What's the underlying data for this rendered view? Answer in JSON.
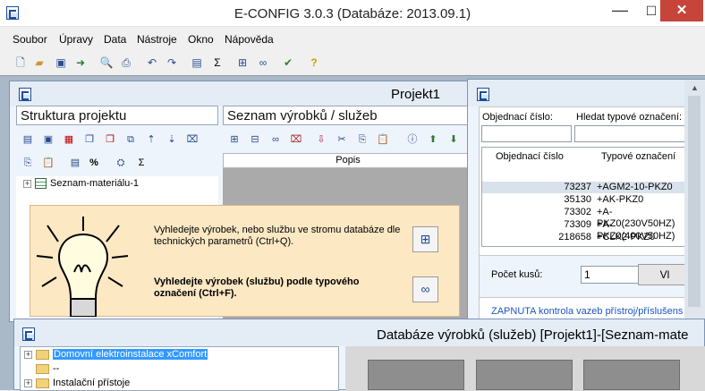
{
  "app": {
    "title": "E-CONFIG 3.0.3  (Databáze: 2013.09.1)",
    "min": "—",
    "max": "☐",
    "close": "✕"
  },
  "menu": [
    "Soubor",
    "Úpravy",
    "Data",
    "Nástroje",
    "Okno",
    "Nápověda"
  ],
  "toolbar_icons": [
    "new-file-icon",
    "open-folder-icon",
    "save-icon",
    "export-icon",
    "print-preview-icon",
    "print-icon",
    "undo-icon",
    "redo-icon",
    "properties-icon",
    "sum-icon",
    "tree-search-icon",
    "binoculars-icon",
    "check-list-icon",
    "help-icon"
  ],
  "project_window": {
    "title": "Projekt1",
    "structure_header": "Struktura projektu",
    "products_header": "Seznam výrobků / služeb",
    "column_popis": "Popis",
    "tree_item": "Seznam-materiálu-1",
    "percent": "%",
    "sigma": "Σ"
  },
  "hint": {
    "text1": "Vyhledejte výrobek, nebo službu ve stromu databáze dle technických parametrů (Ctrl+Q).",
    "text2": "Vyhledejte výrobek (službu) podle typového označení (Ctrl+F)."
  },
  "search_window": {
    "label_order": "Objednací číslo:",
    "label_type": "Hledat typové označení:",
    "col_order": "Objednací číslo",
    "col_type": "Typové označení",
    "rows": [
      {
        "order": "73237",
        "type": "+AGM2-10-PKZ0"
      },
      {
        "order": "35130",
        "type": "+AK-PKZ0"
      },
      {
        "order": "73302",
        "type": "+A-PKZ0(230V50HZ)"
      },
      {
        "order": "73309",
        "type": "+A-PKZ0(400V50HZ)"
      },
      {
        "order": "218658",
        "type": "+CLK2-PKZ0"
      }
    ],
    "qty_label": "Počet kusů:",
    "qty_value": "1",
    "add_btn": "Vl",
    "status": "ZAPNUTA kontrola vazeb přístroj/příslušens"
  },
  "db_window": {
    "title": "Databáze výrobků (služeb) [Projekt1]-[Seznam-mate",
    "tree": [
      {
        "label": "Domovní elektroinstalace xComfort",
        "selected": true
      },
      {
        "label": "--",
        "selected": false
      },
      {
        "label": "Instalační přístoje",
        "selected": false
      }
    ]
  }
}
